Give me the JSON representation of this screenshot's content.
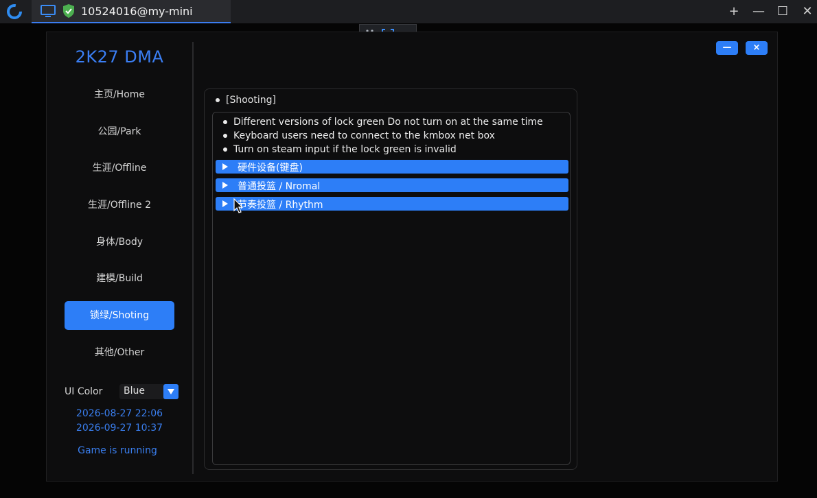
{
  "remote_session": {
    "tab_title": "10524016@my-mini",
    "controls": {
      "new_tab": "+",
      "minimize": "—",
      "maximize": "☐",
      "close": "✕"
    }
  },
  "app": {
    "brand": "2K27 DMA",
    "nav": [
      {
        "label": "主页/Home",
        "active": false
      },
      {
        "label": "公园/Park",
        "active": false
      },
      {
        "label": "生涯/Offline",
        "active": false
      },
      {
        "label": "生涯/Offline 2",
        "active": false
      },
      {
        "label": "身体/Body",
        "active": false
      },
      {
        "label": "建模/Build",
        "active": false
      },
      {
        "label": "锁绿/Shoting",
        "active": true
      },
      {
        "label": "其他/Other",
        "active": false
      }
    ],
    "ui_color_label": "UI Color",
    "ui_color_value": "Blue",
    "dates": [
      "2026-08-27 22:06",
      "2026-09-27 10:37"
    ],
    "status": "Game is running",
    "window_buttons": {
      "minimize": "—",
      "close": "×"
    }
  },
  "content": {
    "section_title": "[Shooting]",
    "notes": [
      "Different versions of lock green Do not turn on at the same time",
      "Keyboard users need to connect to the kmbox net box",
      "Turn on steam input if the lock green is invalid"
    ],
    "groups": [
      {
        "label": "硬件设备(键盘)"
      },
      {
        "label": "普通投篮 / Nromal"
      },
      {
        "label": "节奏投篮 / Rhythm"
      }
    ]
  },
  "colors": {
    "accent": "#2d7ef7",
    "brand": "#3b7ff5",
    "background": "#0d0d0e"
  }
}
